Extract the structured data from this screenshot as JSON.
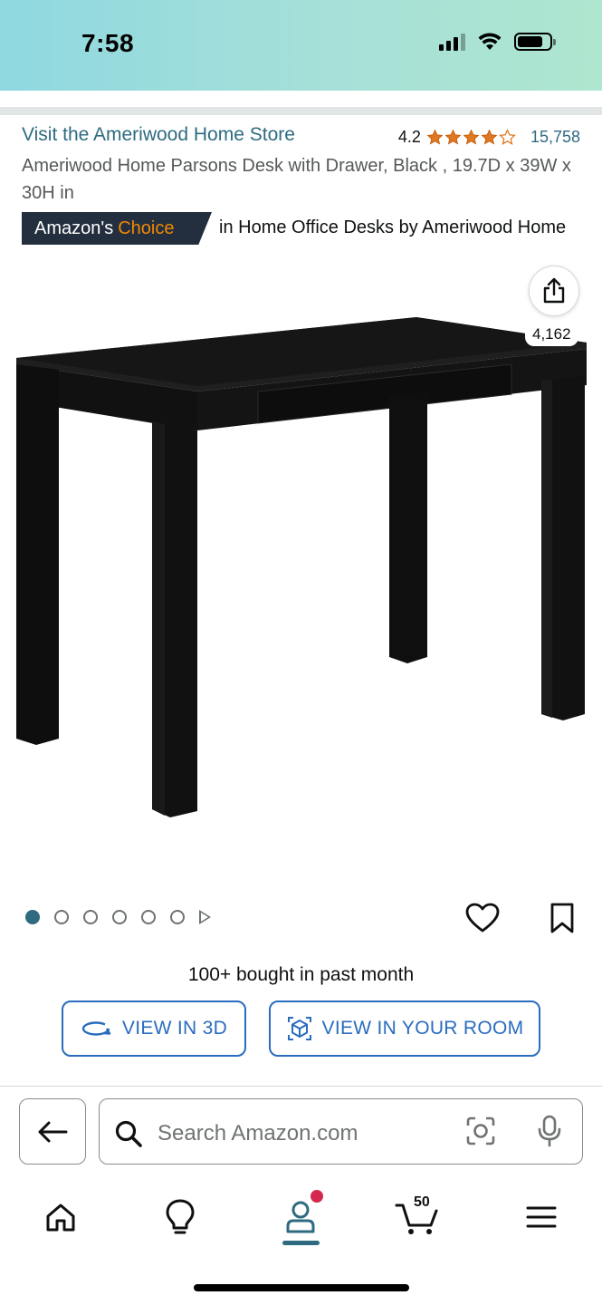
{
  "status_bar": {
    "time": "7:58"
  },
  "header": {
    "store_link": "Visit the Ameriwood Home Store",
    "rating": "4.2",
    "rating_stars": 4.2,
    "review_count": "15,758",
    "title": "Ameriwood Home Parsons Desk with Drawer, Black , 19.7D x 39W x 30H in"
  },
  "badge": {
    "prefix": "Amazon's",
    "highlight": "Choice",
    "category_text": "in Home Office Desks by Ameriwood Home"
  },
  "share": {
    "count": "4,162"
  },
  "gallery": {
    "total_dots": 6,
    "active_index": 0
  },
  "social_proof": {
    "bought_text": "100+ bought in past month"
  },
  "buttons": {
    "view_3d": "VIEW IN 3D",
    "view_room": "VIEW IN YOUR ROOM"
  },
  "search": {
    "placeholder": "Search Amazon.com"
  },
  "bottom_nav": {
    "items": [
      "home-icon",
      "lightbulb-icon",
      "account-icon",
      "cart-icon",
      "menu-icon"
    ],
    "cart_count": "50"
  },
  "colors": {
    "link": "#2e6b80",
    "star": "#de7921",
    "button_blue": "#2a6cbf",
    "badge_bg": "#232f3e",
    "badge_orange": "#f08804",
    "notification": "#d5284f"
  }
}
